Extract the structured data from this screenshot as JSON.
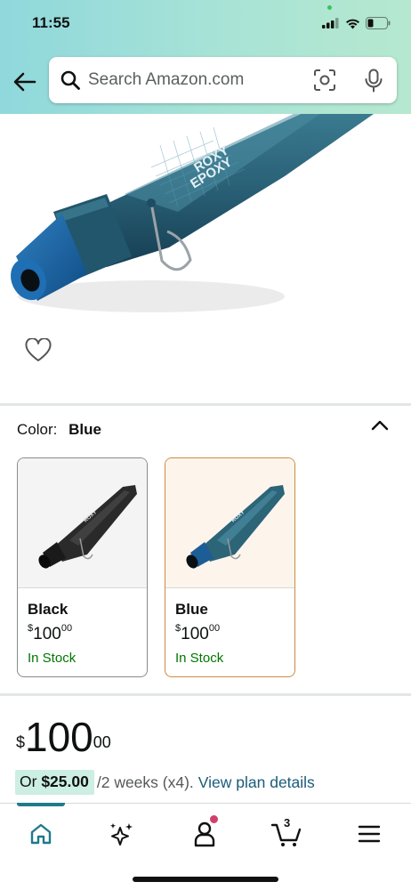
{
  "status_bar": {
    "time": "11:55"
  },
  "search": {
    "placeholder": "Search Amazon.com"
  },
  "color_selector": {
    "label": "Color:",
    "selected": "Blue",
    "options": [
      {
        "name": "Black",
        "price_symbol": "$",
        "price_whole": "100",
        "price_cents": "00",
        "stock": "In Stock"
      },
      {
        "name": "Blue",
        "price_symbol": "$",
        "price_whole": "100",
        "price_cents": "00",
        "stock": "In Stock"
      }
    ]
  },
  "price": {
    "symbol": "$",
    "whole": "100",
    "cents": "00"
  },
  "installment": {
    "prefix": "Or",
    "amount": "$25.00",
    "period": "/2 weeks (x4).",
    "link": "View plan details"
  },
  "bottom_nav": {
    "cart_count": "3"
  },
  "colors": {
    "accent_teal": "#1f7a8c",
    "in_stock_green": "#007600",
    "selected_border": "#c98d3f",
    "link_blue": "#1b5b7a"
  }
}
